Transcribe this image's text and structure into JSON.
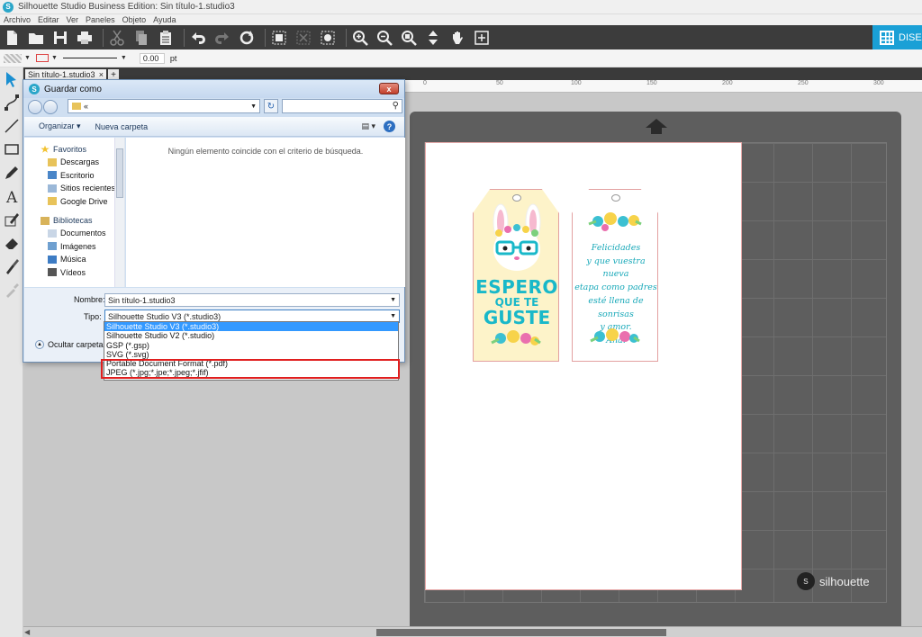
{
  "app": {
    "title": "Silhouette Studio Business Edition: Sin título-1.studio3",
    "icon_glyph": "S",
    "menu": [
      "Archivo",
      "Editar",
      "Ver",
      "Paneles",
      "Objeto",
      "Ayuda"
    ],
    "design_tab": "DISE",
    "doc_tab": "Sin título-1.studio3",
    "doc_tab_close": "×",
    "doc_tab_add": "+"
  },
  "stylebar": {
    "line_width": "0.00",
    "unit": "pt"
  },
  "ruler": {
    "ticks": [
      "0",
      "50",
      "100",
      "150",
      "200",
      "250",
      "300"
    ]
  },
  "mat": {
    "brand": "silhouette",
    "brand_glyph": "s"
  },
  "tag1": {
    "line1": "ESPERO",
    "line2": "QUE TE",
    "line3": "GUSTE"
  },
  "tag2": {
    "lines": [
      "Felicidades",
      "y que vuestra nueva",
      "etapa como padres",
      "esté llena de sonrisas",
      "y amor.",
      "Ana."
    ]
  },
  "dialog": {
    "title": "Guardar como",
    "icon_glyph": "S",
    "close_glyph": "x",
    "address": "«",
    "search_glyph": "⚲",
    "refresh_glyph": "↻",
    "cmd_organize": "Organizar ▾",
    "cmd_new_folder": "Nueva carpeta",
    "view_glyph": "▤ ▾",
    "help_glyph": "?",
    "nav": {
      "favorites": "Favoritos",
      "fav_items": [
        "Descargas",
        "Escritorio",
        "Sitios recientes",
        "Google Drive"
      ],
      "libraries": "Bibliotecas",
      "lib_items": [
        "Documentos",
        "Imágenes",
        "Música",
        "Vídeos"
      ]
    },
    "empty_message": "Ningún elemento coincide con el criterio de búsqueda.",
    "name_label": "Nombre:",
    "name_value": "Sin título-1.studio3",
    "type_label": "Tipo:",
    "type_value": "Silhouette Studio V3 (*.studio3)",
    "hide_folders": "Ocultar carpetas",
    "type_options": [
      "Silhouette Studio V3 (*.studio3)",
      "Silhouette Studio V2 (*.studio)",
      "GSP (*.gsp)",
      "SVG (*.svg)",
      "Portable Document Format (*.pdf)",
      "JPEG (*.jpg;*.jpe;*.jpeg;*.jfif)"
    ]
  },
  "colors": {
    "toolbar_bg": "#3c3c3c",
    "accent": "#1aa0d6",
    "highlight_box": "#e01f1f",
    "selected_option": "#3399ff"
  }
}
